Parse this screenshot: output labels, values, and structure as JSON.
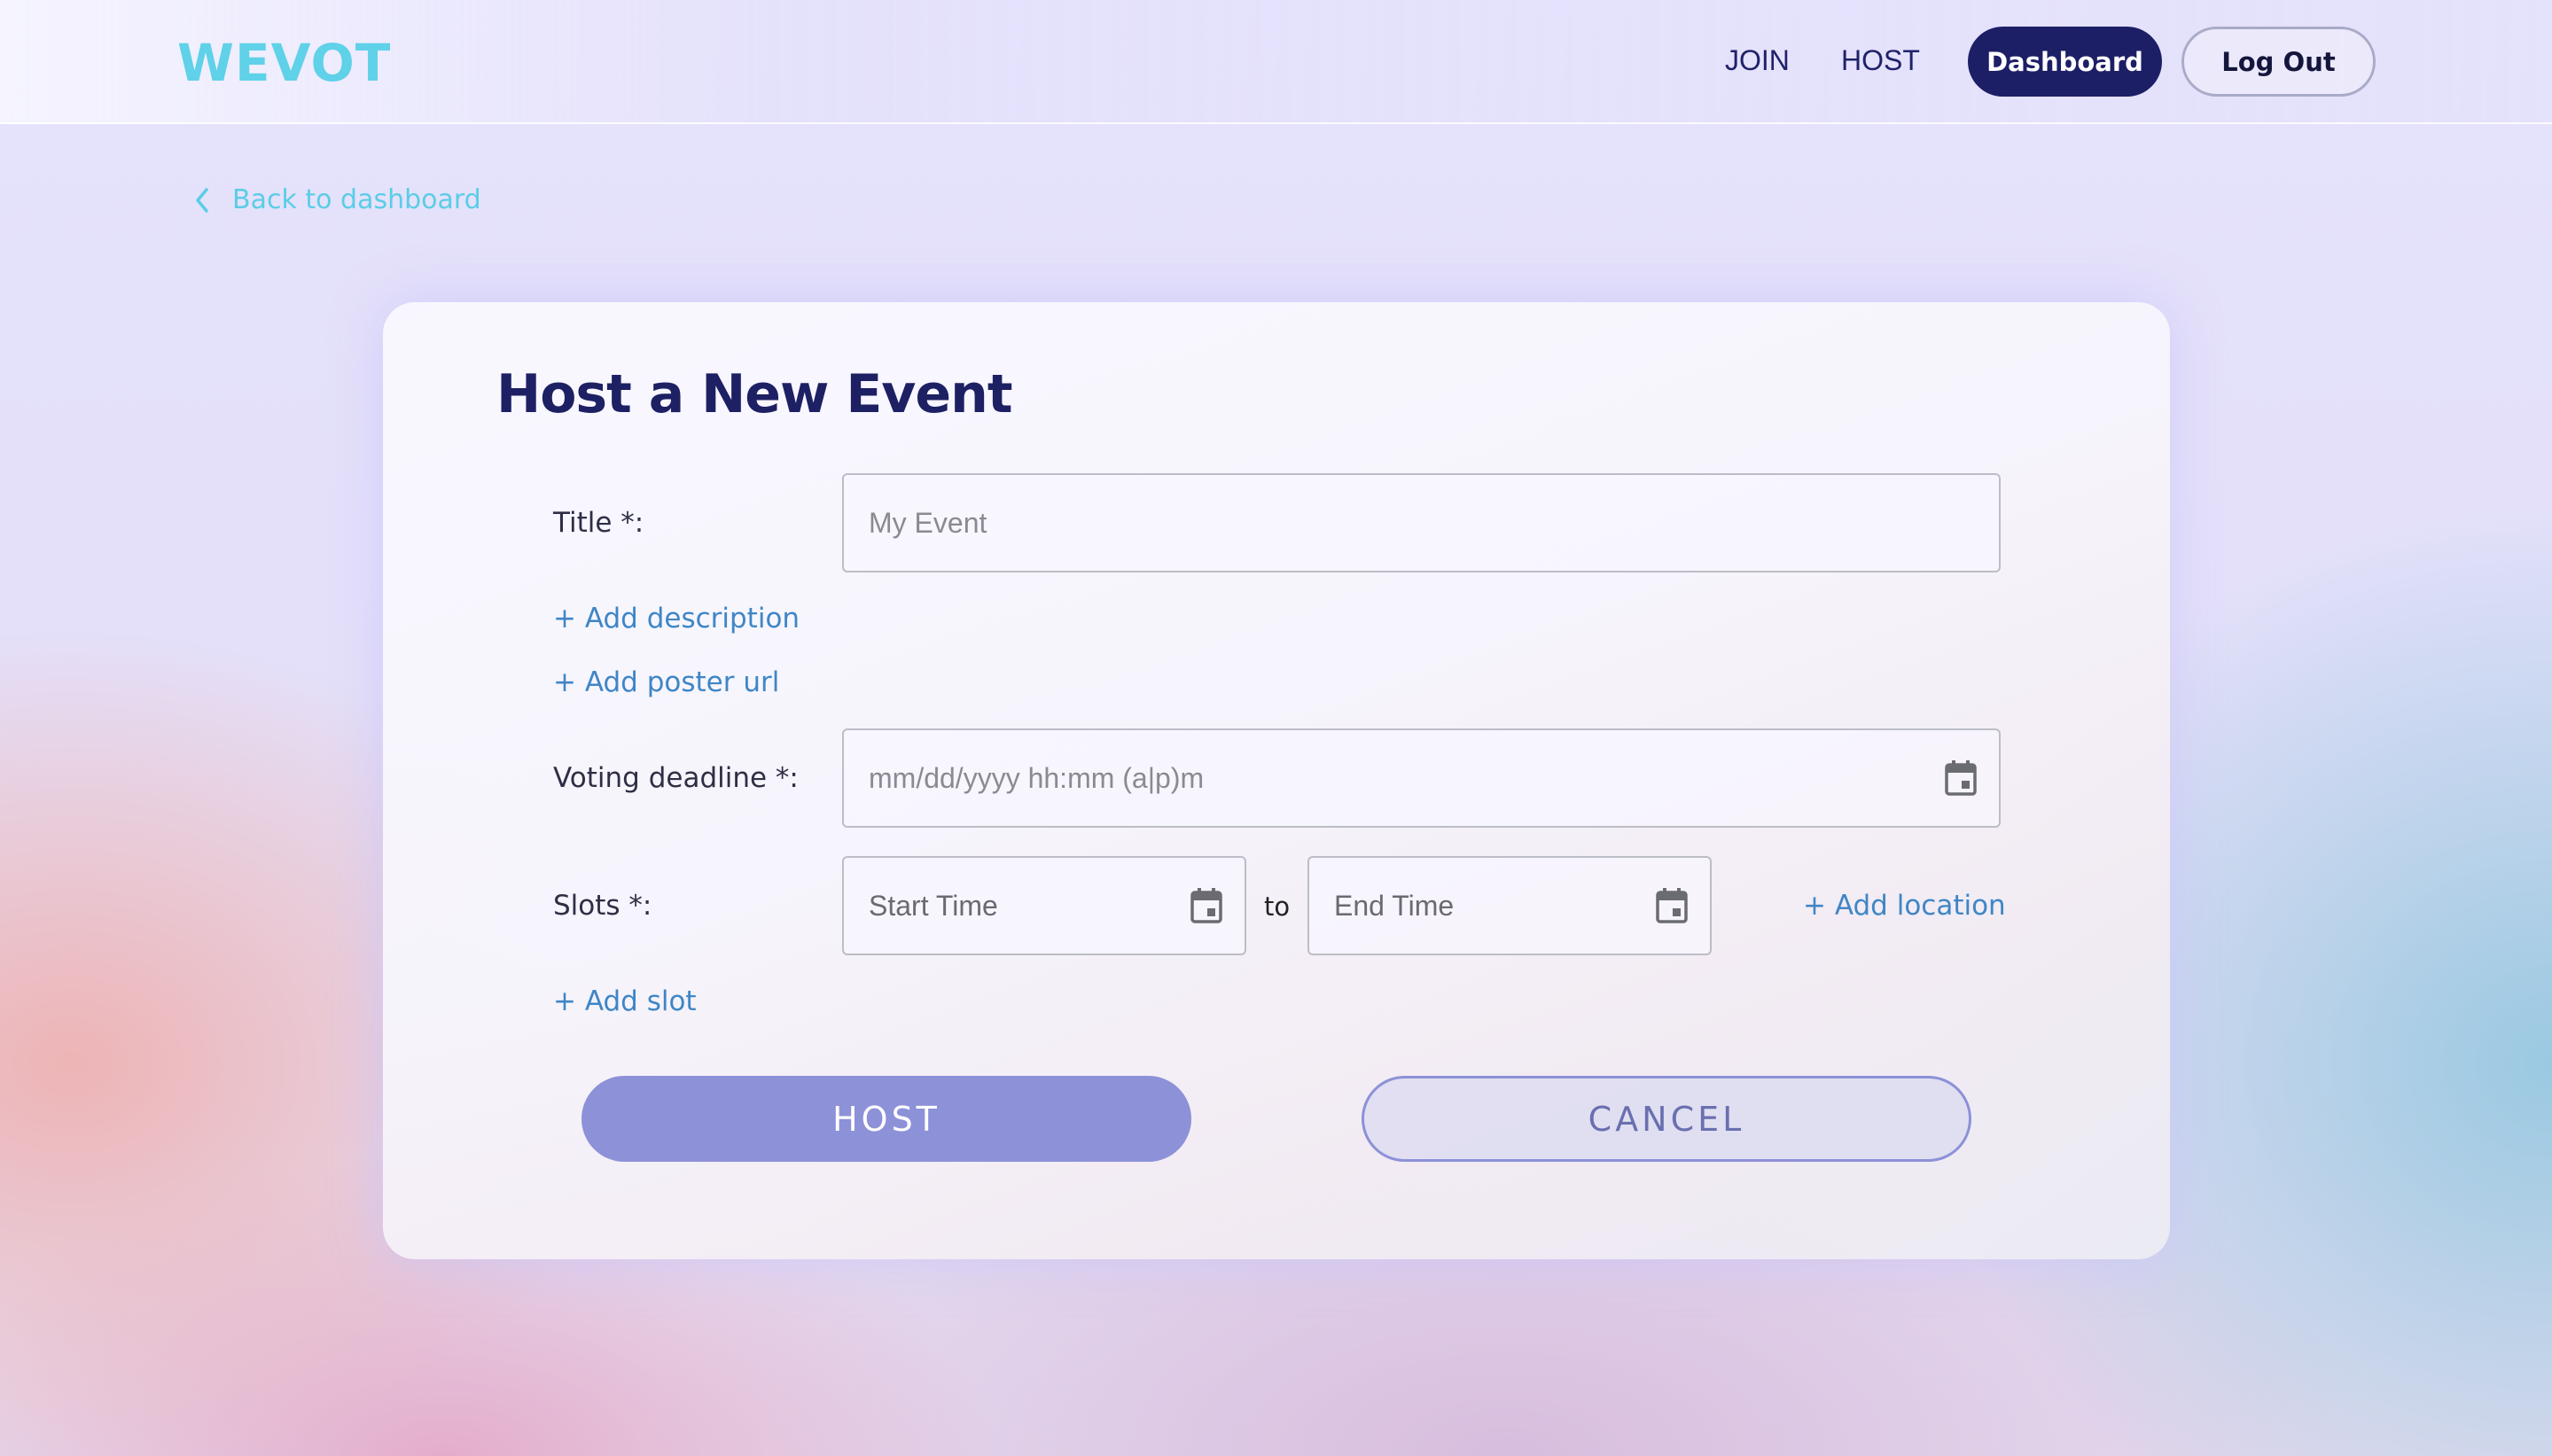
{
  "header": {
    "logo": "WEVOT",
    "nav": {
      "join": "JOIN",
      "host": "HOST"
    },
    "dashboard_button": "Dashboard",
    "logout_button": "Log Out"
  },
  "back_link": {
    "label": "Back to dashboard",
    "icon": "chevron-left-icon"
  },
  "form": {
    "title": "Host a New Event",
    "fields": {
      "title": {
        "label": "Title *:",
        "placeholder": "My Event",
        "value": ""
      },
      "add_description": "+ Add description",
      "add_poster_url": "+ Add poster url",
      "voting_deadline": {
        "label": "Voting deadline *:",
        "placeholder": "mm/dd/yyyy hh:mm (a|p)m",
        "icon": "calendar-icon"
      },
      "slots": {
        "label": "Slots *:",
        "start_placeholder": "Start Time",
        "separator": "to",
        "end_placeholder": "End Time",
        "add_location": "+ Add location"
      },
      "add_slot": "+ Add slot"
    },
    "buttons": {
      "host": "HOST",
      "cancel": "CANCEL"
    }
  },
  "colors": {
    "brand_cyan": "#5fd1e8",
    "navy": "#1c1f66",
    "link_blue": "#3f86c6",
    "host_button": "#8c91d8"
  }
}
